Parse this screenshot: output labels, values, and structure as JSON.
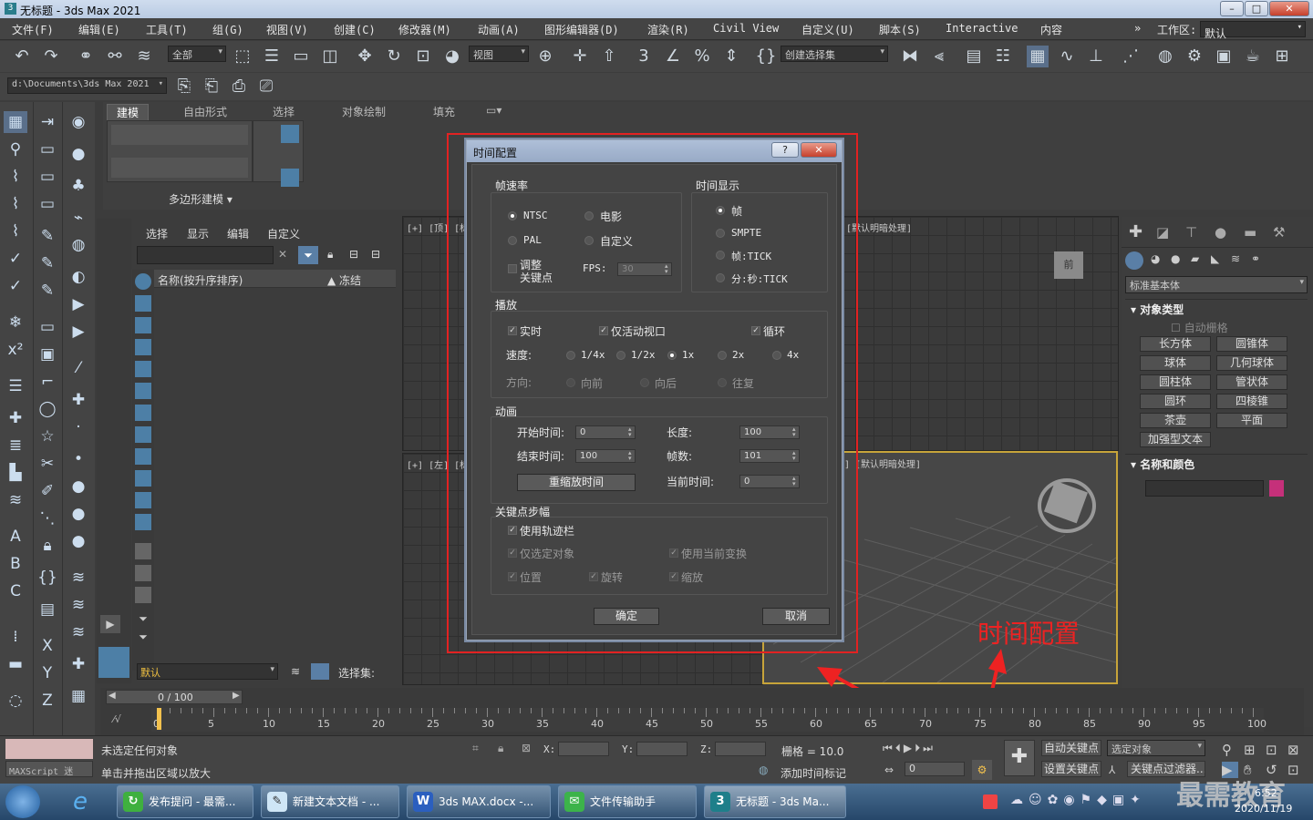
{
  "window": {
    "title": "无标题 - 3ds Max 2021",
    "min": "–",
    "max": "□",
    "close": "✕"
  },
  "menu": [
    "文件(F)",
    "编辑(E)",
    "工具(T)",
    "组(G)",
    "视图(V)",
    "创建(C)",
    "修改器(M)",
    "动画(A)",
    "图形编辑器(D)",
    "渲染(R)",
    "Civil View",
    "自定义(U)",
    "脚本(S)",
    "Interactive",
    "内容"
  ],
  "workspace": {
    "label": "工作区:",
    "value": "默认"
  },
  "toolbar": {
    "filter": "全部",
    "view": "视图",
    "selection_set": "创建选择集"
  },
  "project_path": "d:\\Documents\\3ds Max 2021",
  "ribbon": {
    "tabs": [
      "建模",
      "自由形式",
      "选择",
      "对象绘制",
      "填充"
    ],
    "poly": "多边形建模"
  },
  "explorer": {
    "tabs": [
      "选择",
      "显示",
      "编辑",
      "自定义"
    ],
    "col_name": "名称(按升序排序)",
    "col_freeze": "▲ 冻结",
    "layer": "默认",
    "selset": "选择集:"
  },
  "viewports": {
    "top": "[+] [顶] [标",
    "left": "[+] [左] [标",
    "persp_top": "[默认明暗处理]",
    "persp": "] [默认明暗处理]",
    "cube": "前"
  },
  "command": {
    "category": "标准基本体",
    "section1": "对象类型",
    "autogrid": "自动栅格",
    "buttons": [
      "长方体",
      "圆锥体",
      "球体",
      "几何球体",
      "圆柱体",
      "管状体",
      "圆环",
      "四棱锥",
      "茶壶",
      "平面",
      "加强型文本"
    ],
    "section2": "名称和颜色",
    "color": "#c5307a"
  },
  "dialog": {
    "title": "时间配置",
    "help": "?",
    "close": "✕",
    "frame_rate": {
      "title": "帧速率",
      "ntsc": "NTSC",
      "film": "电影",
      "pal": "PAL",
      "custom": "自定义",
      "adjust1": "调整",
      "adjust2": "关键点",
      "fps_label": "FPS:",
      "fps": "30"
    },
    "time_display": {
      "title": "时间显示",
      "frames": "帧",
      "smpte": "SMPTE",
      "frame_tick": "帧:TICK",
      "mmss_tick": "分:秒:TICK"
    },
    "playback": {
      "title": "播放",
      "realtime": "实时",
      "active_only": "仅活动视口",
      "loop": "循环",
      "speed": "速度:",
      "s1": "1/4x",
      "s2": "1/2x",
      "s3": "1x",
      "s4": "2x",
      "s5": "4x",
      "direction": "方向:",
      "d1": "向前",
      "d2": "向后",
      "d3": "往复"
    },
    "animation": {
      "title": "动画",
      "start_label": "开始时间:",
      "start": "0",
      "end_label": "结束时间:",
      "end": "100",
      "length_label": "长度:",
      "length": "100",
      "count_label": "帧数:",
      "count": "101",
      "current_label": "当前时间:",
      "current": "0",
      "rescale": "重缩放时间"
    },
    "key_steps": {
      "title": "关键点步幅",
      "use_trackbar": "使用轨迹栏",
      "selected_only": "仅选定对象",
      "use_transform": "使用当前变换",
      "position": "位置",
      "rotation": "旋转",
      "scale": "缩放"
    },
    "ok": "确定",
    "cancel": "取消"
  },
  "annotation": {
    "label": "时间配置",
    "color": "#e22222"
  },
  "timeline": {
    "counter": "0 / 100",
    "ticks": [
      "0",
      "5",
      "10",
      "15",
      "20",
      "25",
      "30",
      "35",
      "40",
      "45",
      "50",
      "55",
      "60",
      "65",
      "70",
      "75",
      "80",
      "85",
      "90",
      "95",
      "100"
    ]
  },
  "status": {
    "script": "MAXScript 迷",
    "msg1": "未选定任何对象",
    "msg2": "单击并拖出区域以放大",
    "x": "X:",
    "y": "Y:",
    "z": "Z:",
    "grid": "栅格 = 10.0",
    "add_tag": "添加时间标记",
    "autokey": "自动关键点",
    "selected": "选定对象",
    "setkey": "设置关键点",
    "keyfilter": "关键点过滤器...",
    "frame": "0"
  },
  "taskbar": {
    "items": [
      "发布提问 - 最需...",
      "新建文本文档 - ...",
      "3ds MAX.docx -...",
      "文件传输助手",
      "无标题 - 3ds Ma..."
    ],
    "time": "6:52",
    "date": "2020/11/19",
    "watermark": "最需教育"
  }
}
